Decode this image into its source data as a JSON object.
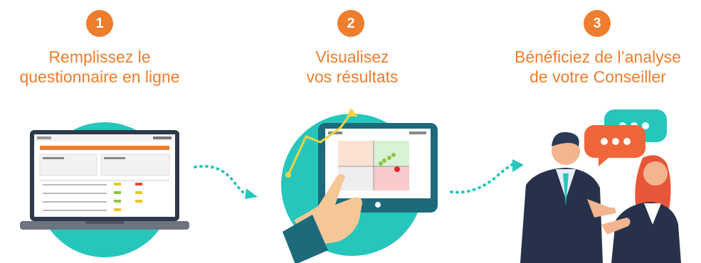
{
  "steps": [
    {
      "number": "1",
      "title": "Remplissez le\nquestionnaire en ligne"
    },
    {
      "number": "2",
      "title": "Visualisez\nvos résultats"
    },
    {
      "number": "3",
      "title": "Bénéficiez de l’analyse\nde votre Conseiller"
    }
  ],
  "colors": {
    "accent": "#ee7d2e",
    "teal": "#26c6bd",
    "dark_teal": "#1d6a7c",
    "navy": "#27324a"
  },
  "icons": [
    "laptop-illustration",
    "tablet-chart-illustration",
    "advisor-conversation-illustration",
    "dotted-arrow-icon"
  ]
}
